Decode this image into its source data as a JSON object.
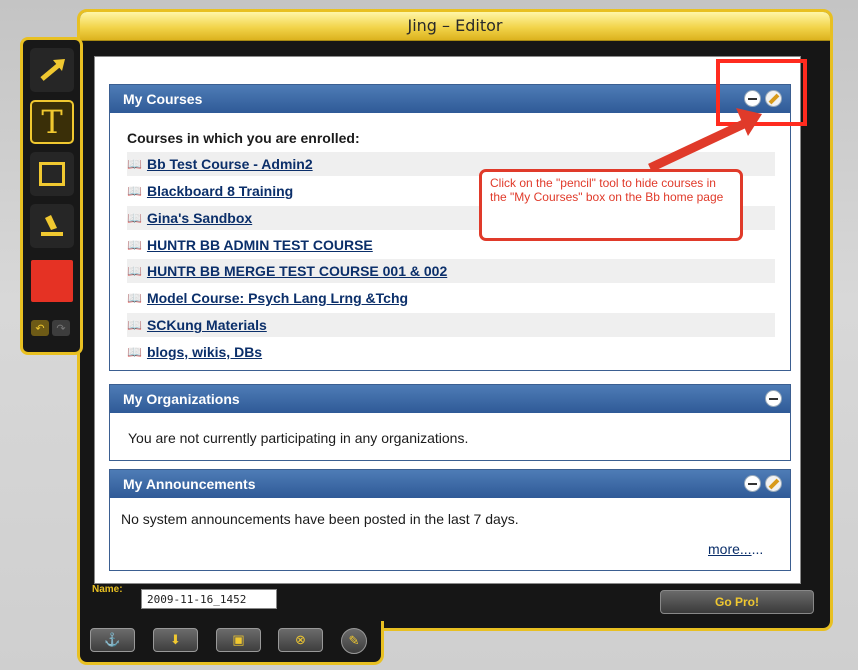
{
  "window": {
    "title": "Jing – Editor"
  },
  "toolbar": {
    "tools": [
      "arrow-tool",
      "text-tool",
      "rectangle-tool",
      "highlighter-tool",
      "color-swatch"
    ],
    "text_glyph": "T",
    "color": "#e53224"
  },
  "accent": "#e8c022",
  "modules": {
    "courses": {
      "title": "My Courses",
      "subtitle": "Courses in which you are enrolled:",
      "items": [
        "Bb Test Course - Admin2",
        "Blackboard 8 Training",
        "Gina's Sandbox",
        "HUNTR BB ADMIN TEST COURSE",
        "HUNTR BB MERGE TEST COURSE 001 & 002",
        "Model Course: Psych Lang Lrng &Tchg",
        "SCKung Materials",
        "blogs, wikis, DBs"
      ]
    },
    "organizations": {
      "title": "My Organizations",
      "message": "You are not currently participating in any organizations."
    },
    "announcements": {
      "title": "My Announcements",
      "message": "No system announcements have been posted in the last 7 days.",
      "more": "more...",
      "more_suffix": "..."
    }
  },
  "annotation": {
    "callout": "Click on the \"pencil\" tool to hide courses in the \"My Courses\" box on the Bb home page"
  },
  "bottom": {
    "name_label": "Name:",
    "name_value": "2009-11-16_1452",
    "gopro_label": "Go Pro!"
  }
}
